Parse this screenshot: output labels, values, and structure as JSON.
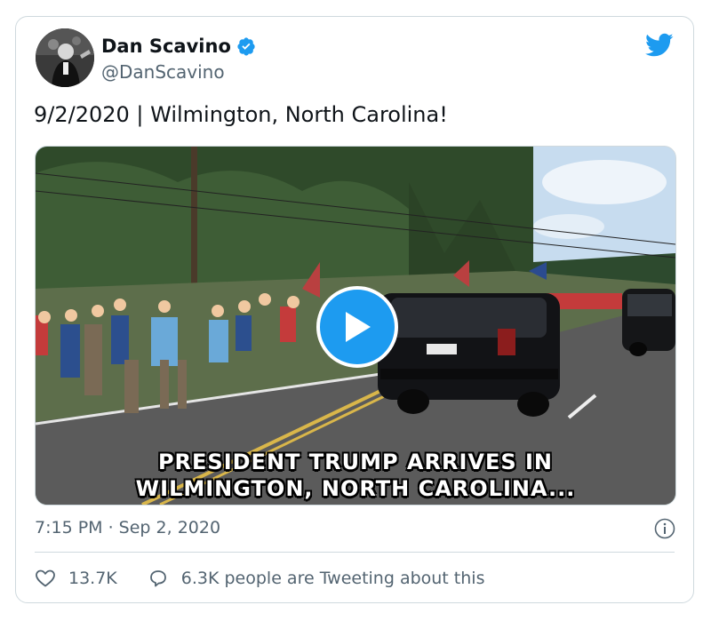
{
  "author": {
    "name": "Dan Scavino",
    "handle": "@DanScavino"
  },
  "tweet": {
    "text": "9/2/2020 | Wilmington, North Carolina!"
  },
  "media": {
    "caption_line1": "PRESIDENT TRUMP ARRIVES IN",
    "caption_line2": "WILMINGTON, NORTH CAROLINA..."
  },
  "meta": {
    "timestamp": "7:15 PM · Sep 2, 2020"
  },
  "actions": {
    "likes": "13.7K",
    "tweeting": "6.3K people are Tweeting about this"
  },
  "colors": {
    "brand_blue": "#1d9bf0",
    "text_secondary": "#536471",
    "border": "#cfd9de"
  },
  "icons": [
    "twitter-bird-icon",
    "verified-badge-icon",
    "play-icon",
    "info-icon",
    "heart-icon",
    "speech-bubble-icon"
  ]
}
